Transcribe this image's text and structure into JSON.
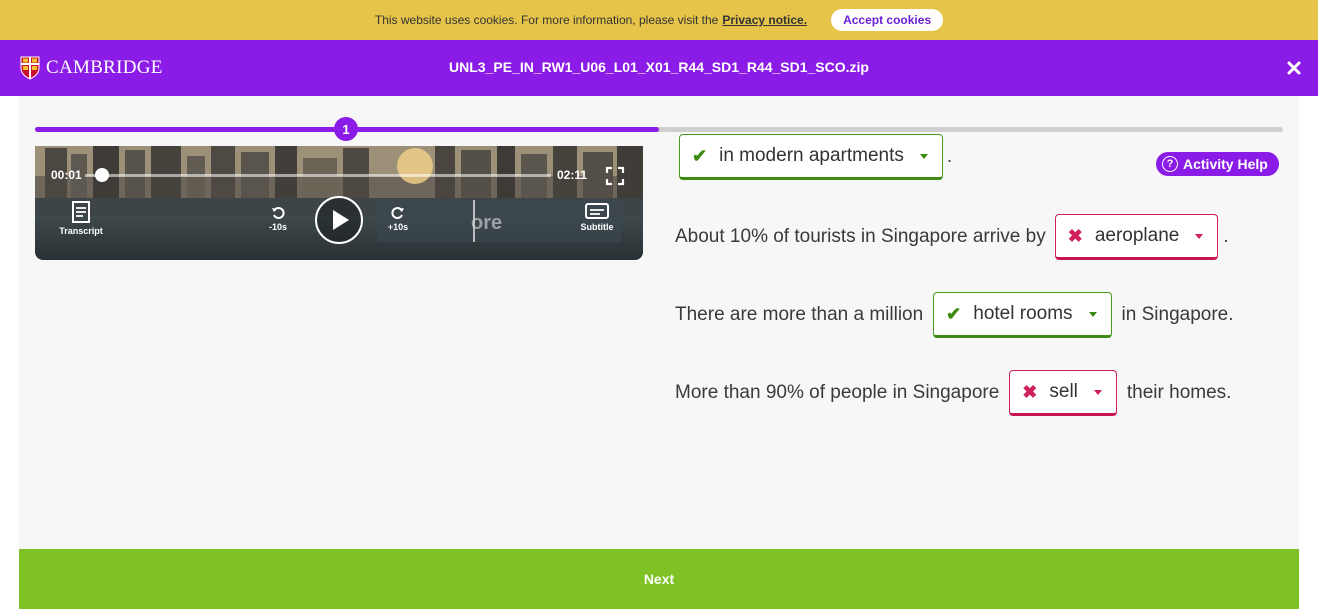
{
  "cookie_bar": {
    "text": "This website uses cookies. For more information, please visit the",
    "privacy_link": "Privacy notice.",
    "accept_label": "Accept cookies"
  },
  "header": {
    "brand": "CAMBRIDGE",
    "file_title": "UNL3_PE_IN_RW1_U06_L01_X01_R44_SD1_R44_SD1_SCO.zip",
    "close_icon": "close-icon"
  },
  "progress": {
    "current_step": "1",
    "fill_fraction": 0.5
  },
  "video": {
    "current_time": "00:01",
    "duration": "02:11",
    "seek_fraction": 0.01,
    "transcript_label": "Transcript",
    "rewind_label": "-10s",
    "forward_label": "+10s",
    "subtitle_label": "Subtitle",
    "subtitle_fragment": "ore"
  },
  "activity_help": {
    "label": "Activity Help",
    "icon": "question-circle-icon"
  },
  "sentences": [
    {
      "before": "",
      "answer": "in modern apartments",
      "status": "correct",
      "after": "."
    },
    {
      "before": "About 10% of tourists in Singapore arrive by",
      "answer": "aeroplane",
      "status": "wrong",
      "after": "."
    },
    {
      "before": "There are more than a million",
      "answer": "hotel rooms",
      "status": "correct",
      "after": "in Singapore."
    },
    {
      "before": "More than 90% of people in Singapore",
      "answer": "sell",
      "status": "wrong",
      "after": "their homes."
    }
  ],
  "next_label": "Next",
  "colors": {
    "brand_purple": "#8b1ce8",
    "cookie_yellow": "#e6c44a",
    "next_green": "#7ec226",
    "correct_green": "#3c8a12",
    "wrong_red": "#d0215d"
  }
}
